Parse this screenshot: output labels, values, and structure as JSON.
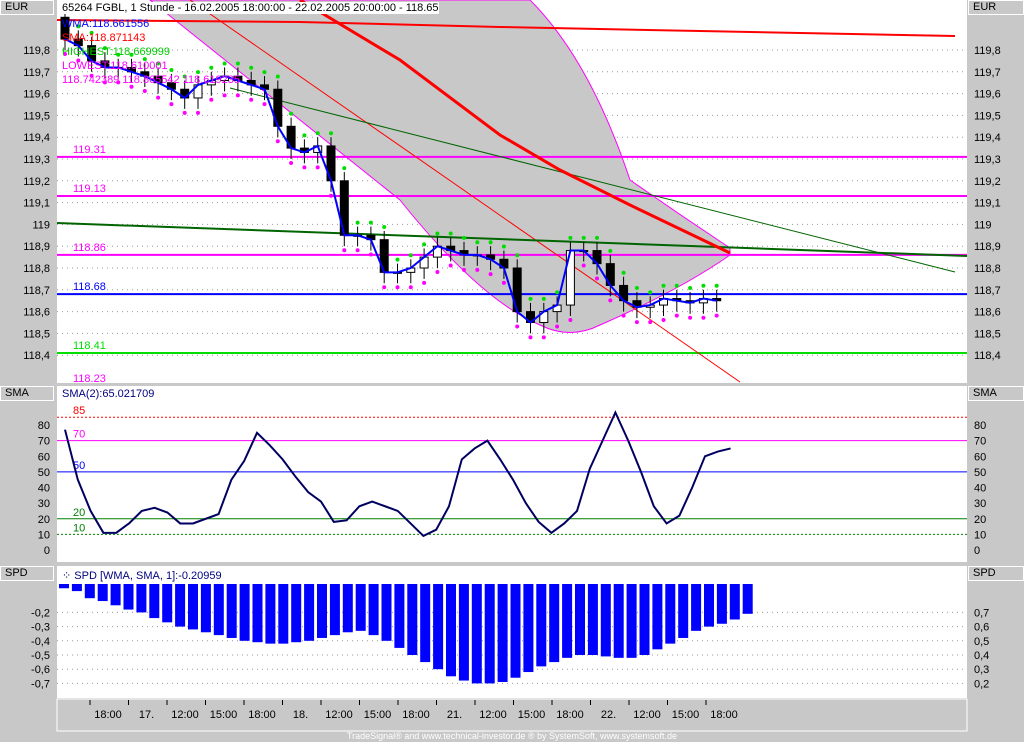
{
  "chart_data": [
    {
      "type": "candlestick",
      "title": "65264 FGBL, 1 Stunde - 16.02.2005 18:00:00 - 22.02.2005 20:00:00 - 118.65",
      "axis_label": "EUR",
      "ylim": [
        118.35,
        119.98
      ],
      "yticks": [
        "119,8",
        "119,7",
        "119,6",
        "119,5",
        "119,4",
        "119,3",
        "119,2",
        "119,1",
        "119",
        "118,9",
        "118,8",
        "118,7",
        "118,6",
        "118,5",
        "118,4"
      ],
      "ytick_values": [
        119.8,
        119.7,
        119.6,
        119.5,
        119.4,
        119.3,
        119.2,
        119.1,
        119.0,
        118.9,
        118.8,
        118.7,
        118.6,
        118.5,
        118.4
      ],
      "legend": [
        "WMA:118.661556",
        "SMA:118.871143",
        "HIGHEST:118.669999",
        "LOWEST:118.610001",
        "118.742389 118.865542 118.619235"
      ],
      "levels": [
        {
          "label": "119.31",
          "value": 119.31,
          "color": "#ff00ff"
        },
        {
          "label": "119.13",
          "value": 119.13,
          "color": "#ff00ff"
        },
        {
          "label": "118.86",
          "value": 118.86,
          "color": "#ff00ff"
        },
        {
          "label": "118.68",
          "value": 118.68,
          "color": "#0000ff"
        },
        {
          "label": "118.41",
          "value": 118.41,
          "color": "#00dd00"
        },
        {
          "label": "118.23",
          "value": 118.23,
          "color": "#ff00ff"
        }
      ],
      "closes": [
        119.85,
        119.82,
        119.75,
        119.72,
        119.72,
        119.7,
        119.68,
        119.65,
        119.62,
        119.58,
        119.64,
        119.66,
        119.68,
        119.66,
        119.64,
        119.62,
        119.45,
        119.35,
        119.33,
        119.36,
        119.2,
        118.95,
        118.95,
        118.93,
        118.78,
        118.78,
        118.8,
        118.85,
        118.9,
        118.88,
        118.86,
        118.86,
        118.84,
        118.8,
        118.6,
        118.55,
        118.6,
        118.63,
        118.88,
        118.88,
        118.82,
        118.72,
        118.65,
        118.62,
        118.63,
        118.66,
        118.65,
        118.64,
        118.66,
        118.65
      ],
      "first_open": 119.95
    },
    {
      "type": "line",
      "title": "SMA(2):65.021709",
      "axis_label": "SMA",
      "ylim": [
        -5,
        90
      ],
      "yticks": [
        "80",
        "70",
        "60",
        "50",
        "40",
        "30",
        "20",
        "10",
        "0"
      ],
      "ytick_values": [
        80,
        70,
        60,
        50,
        40,
        30,
        20,
        10,
        0
      ],
      "levels": [
        {
          "label": "85",
          "value": 85,
          "color": "#ff0000"
        },
        {
          "label": "70",
          "value": 70,
          "color": "#ff00ff"
        },
        {
          "label": "50",
          "value": 50,
          "color": "#0000ff"
        },
        {
          "label": "20",
          "value": 20,
          "color": "#008000"
        },
        {
          "label": "10",
          "value": 10,
          "color": "#008000"
        }
      ],
      "values": [
        77,
        45,
        25,
        11,
        11,
        17,
        25,
        27,
        24,
        17,
        17,
        20,
        23,
        45,
        57,
        75,
        67,
        58,
        47,
        37,
        31,
        18,
        19,
        28,
        31,
        28,
        25,
        17,
        9,
        13,
        28,
        58,
        65,
        70,
        58,
        45,
        30,
        18,
        11,
        17,
        25,
        52,
        70,
        88,
        70,
        50,
        28,
        17,
        22,
        40,
        60,
        63,
        65
      ]
    },
    {
      "type": "bar",
      "title": "SPD [WMA, SMA, 1]:-0.20959",
      "axis_label": "SPD",
      "ylim": [
        -0.78,
        0.0
      ],
      "yticks": [
        "-0,2",
        "-0,3",
        "-0,4",
        "-0,5",
        "-0,6",
        "-0,7"
      ],
      "ytick_values": [
        -0.2,
        -0.3,
        -0.4,
        -0.5,
        -0.6,
        -0.7
      ],
      "right_yticks": [
        "0,7",
        "0,6",
        "0,5",
        "0,4",
        "0,3",
        "0,2"
      ],
      "values": [
        -0.03,
        -0.05,
        -0.1,
        -0.12,
        -0.15,
        -0.18,
        -0.2,
        -0.24,
        -0.27,
        -0.3,
        -0.32,
        -0.34,
        -0.36,
        -0.38,
        -0.4,
        -0.41,
        -0.42,
        -0.42,
        -0.41,
        -0.4,
        -0.38,
        -0.36,
        -0.34,
        -0.33,
        -0.36,
        -0.4,
        -0.45,
        -0.5,
        -0.55,
        -0.6,
        -0.65,
        -0.68,
        -0.7,
        -0.7,
        -0.69,
        -0.66,
        -0.62,
        -0.58,
        -0.55,
        -0.52,
        -0.5,
        -0.5,
        -0.51,
        -0.52,
        -0.52,
        -0.5,
        -0.46,
        -0.42,
        -0.38,
        -0.33,
        -0.3,
        -0.28,
        -0.25,
        -0.21
      ]
    }
  ],
  "xaxis": {
    "ticks": [
      "18:00",
      "17.",
      "12:00",
      "15:00",
      "18:00",
      "18.",
      "12:00",
      "15:00",
      "18:00",
      "21.",
      "12:00",
      "15:00",
      "18:00",
      "22.",
      "12:00",
      "15:00",
      "18:00"
    ]
  },
  "footer": "TradeSignal® and www.technical-investor.de ® by  SystemSoft, www.systemsoft.de"
}
